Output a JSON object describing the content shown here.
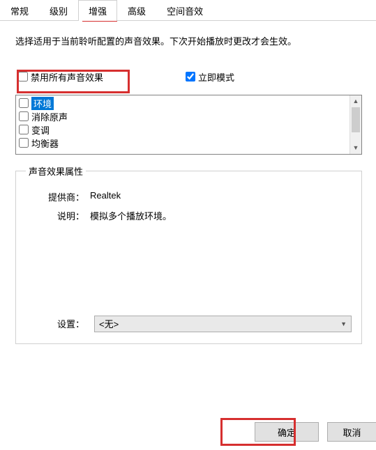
{
  "tabs": {
    "t0": "常规",
    "t1": "级别",
    "t2": "增强",
    "t3": "高级",
    "t4": "空间音效"
  },
  "description": "选择适用于当前聆听配置的声音效果。下次开始播放时更改才会生效。",
  "checkboxes": {
    "disable_all_label": "禁用所有声音效果",
    "immediate_mode_label": "立即模式"
  },
  "effects_list": {
    "items": [
      {
        "label": "环境",
        "selected": true
      },
      {
        "label": "消除原声",
        "selected": false
      },
      {
        "label": "变调",
        "selected": false
      },
      {
        "label": "均衡器",
        "selected": false
      }
    ]
  },
  "groupbox": {
    "legend": "声音效果属性",
    "provider_label": "提供商：",
    "provider_value": "Realtek",
    "desc_label": "说明：",
    "desc_value": "模拟多个播放环境。",
    "settings_label": "设置：",
    "settings_value": "<无>"
  },
  "buttons": {
    "ok": "确定",
    "cancel": "取消"
  }
}
